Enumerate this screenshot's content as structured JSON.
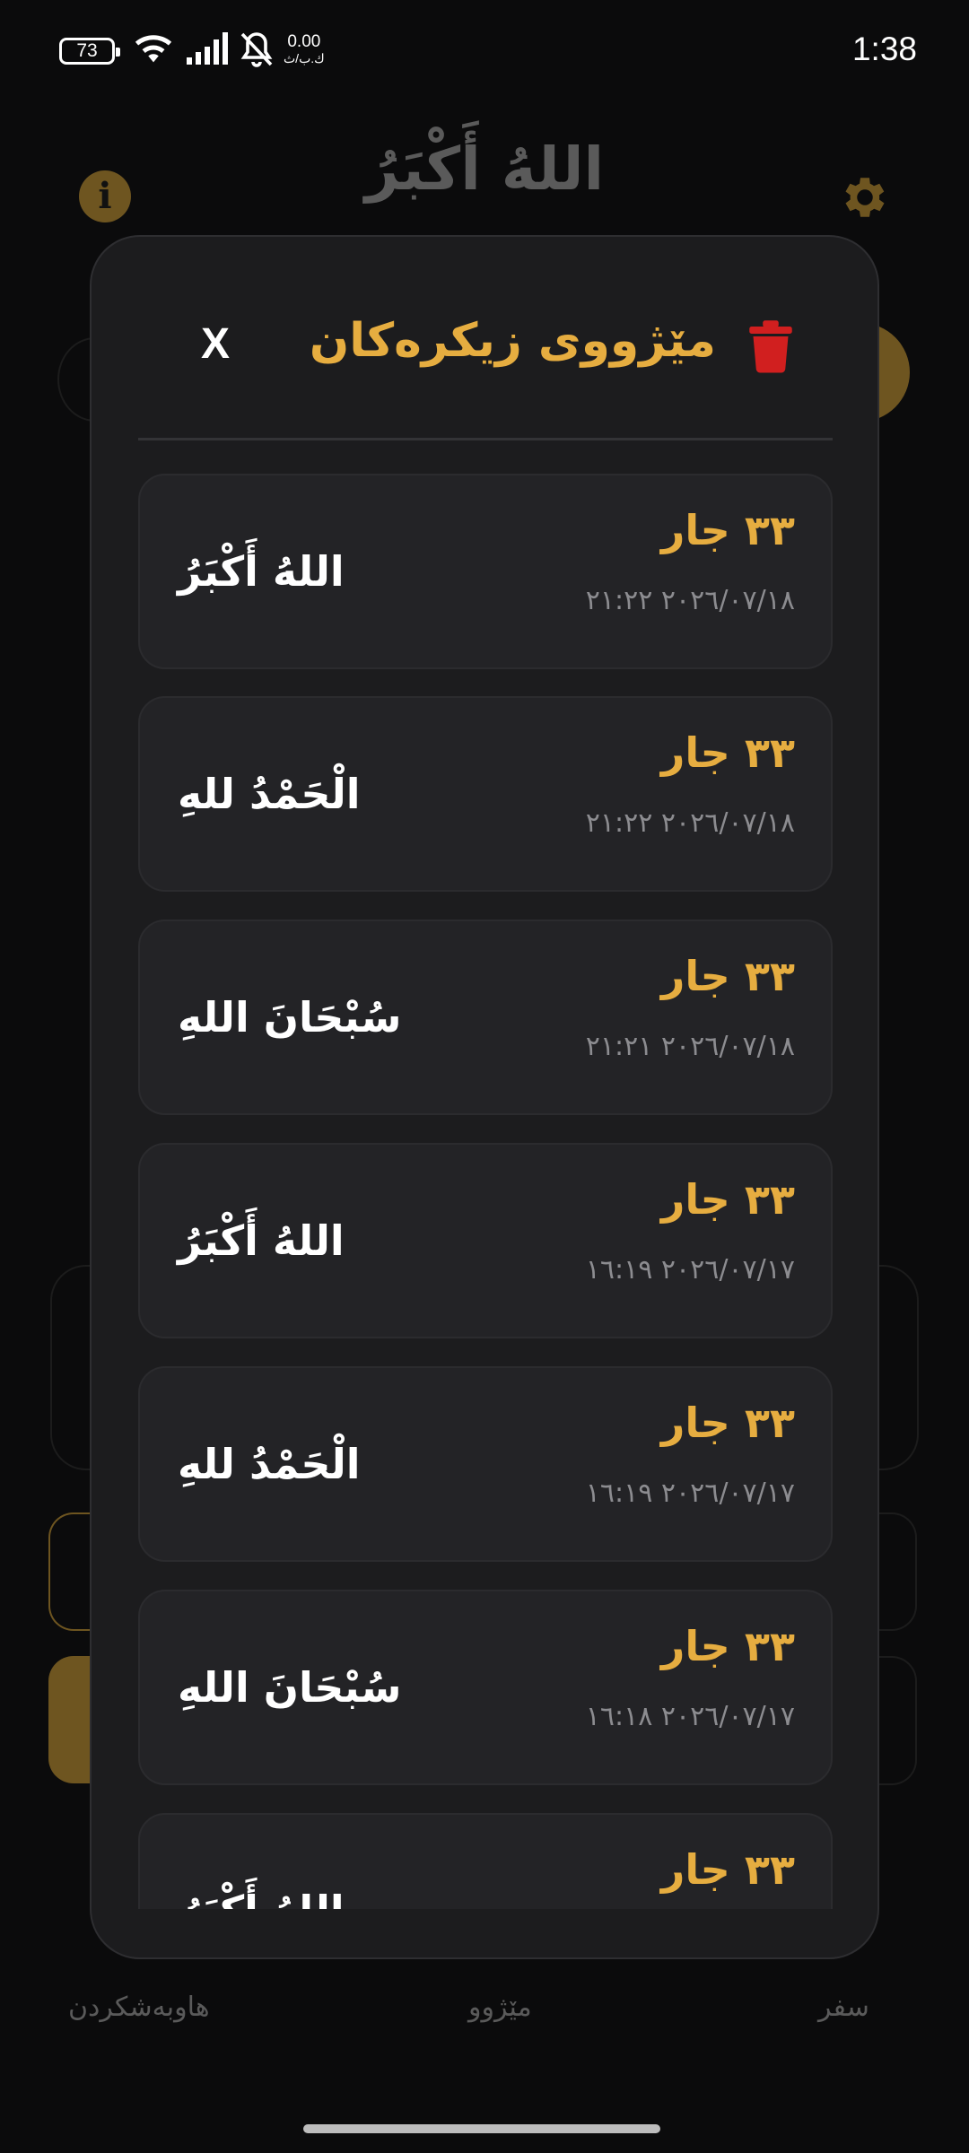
{
  "status_bar": {
    "battery": "73",
    "net_speed_value": "0.00",
    "net_speed_unit": "ك.ب/ث",
    "time": "1:38"
  },
  "background_app": {
    "title": "اللهُ أَكْبَرُ",
    "info_label": "i",
    "nav": {
      "reset": "هاوبەشکردن",
      "history": "مێژوو",
      "zero": "سفر"
    }
  },
  "modal": {
    "title": "مێژووی زیکرەکان",
    "close_label": "X",
    "items": [
      {
        "dhikr": "اللهُ أَكْبَرُ",
        "count": "٣٣ جار",
        "date": "٢٠٢٦/٠٧/١٨ ٢١:٢٢"
      },
      {
        "dhikr": "الْحَمْدُ للهِ",
        "count": "٣٣ جار",
        "date": "٢٠٢٦/٠٧/١٨ ٢١:٢٢"
      },
      {
        "dhikr": "سُبْحَانَ اللهِ",
        "count": "٣٣ جار",
        "date": "٢٠٢٦/٠٧/١٨ ٢١:٢١"
      },
      {
        "dhikr": "اللهُ أَكْبَرُ",
        "count": "٣٣ جار",
        "date": "٢٠٢٦/٠٧/١٧ ١٦:١٩"
      },
      {
        "dhikr": "الْحَمْدُ للهِ",
        "count": "٣٣ جار",
        "date": "٢٠٢٦/٠٧/١٧ ١٦:١٩"
      },
      {
        "dhikr": "سُبْحَانَ اللهِ",
        "count": "٣٣ جار",
        "date": "٢٠٢٦/٠٧/١٧ ١٦:١٨"
      },
      {
        "dhikr": "اللهُ أَكْبَرُ",
        "count": "٣٣ جار",
        "date": ""
      }
    ]
  },
  "colors": {
    "accent": "#e6ad40",
    "trash": "#d11f1f",
    "card": "#232326",
    "modal": "#1c1c1e"
  }
}
